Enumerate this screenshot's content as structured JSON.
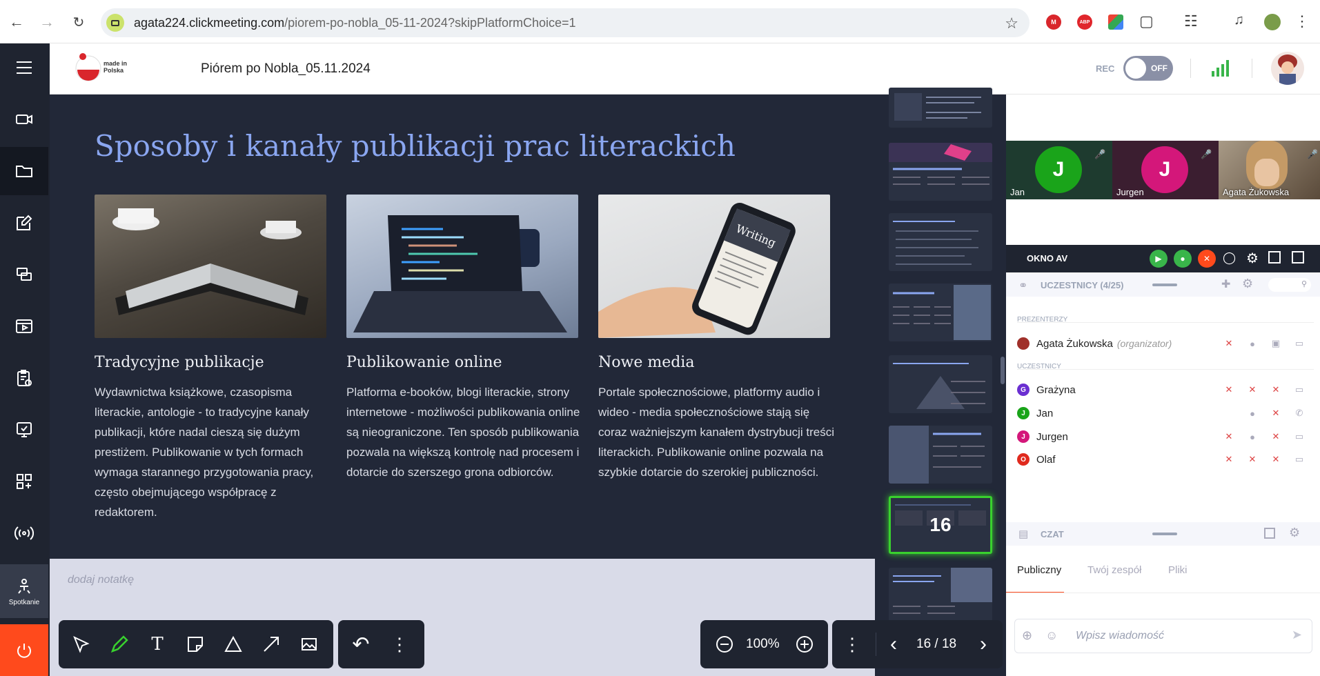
{
  "browser": {
    "url_host": "agata224.clickmeeting.com",
    "url_path": "/piorem-po-nobla_05-11-2024?skipPlatformChoice=1",
    "extensions": [
      "gmail-icon",
      "adblock-icon",
      "drive-icon",
      "puzzle-icon"
    ],
    "abp_label": "ABP"
  },
  "header": {
    "logo_text": "made in Polska",
    "title": "Piórem po Nobla_05.11.2024",
    "rec_label": "REC",
    "toggle_label": "OFF"
  },
  "rail": {
    "meeting_label": "Spotkanie"
  },
  "slide": {
    "title": "Sposoby i kanały publikacji prac literackich",
    "columns": [
      {
        "heading": "Tradycyjne publikacje",
        "body": "Wydawnictwa książkowe, czasopisma literackie, antologie - to tradycyjne kanały publikacji, które nadal cieszą się dużym prestiżem. Publikowanie w tych formach wymaga starannego przygotowania pracy, często obejmującego współpracę z redaktorem."
      },
      {
        "heading": "Publikowanie online",
        "body": "Platforma e-booków, blogi literackie, strony internetowe - możliwości publikowania online są nieograniczone. Ten sposób publikowania pozwala na większą kontrolę nad procesem i dotarcie do szerszego grona odbiorców."
      },
      {
        "heading": "Nowe media",
        "body": "Portale społecznościowe, platformy audio i wideo - media społecznościowe stają się coraz ważniejszym kanałem dystrybucji treści literackich. Publikowanie online pozwala na szybkie dotarcie do szerokiej publiczności."
      }
    ]
  },
  "notes": {
    "placeholder": "dodaj notatkę"
  },
  "thumbnails": {
    "current_number": "16"
  },
  "toolbar": {
    "zoom": "100%",
    "page": "16 / 18"
  },
  "video": {
    "tiles": [
      {
        "initial": "J",
        "name": "Jan",
        "color": "#1aa41a"
      },
      {
        "initial": "J",
        "name": "Jurgen",
        "color": "#d4177a"
      },
      {
        "initial": "",
        "name": "Agata Żukowska",
        "color": "#6b5a4a"
      }
    ]
  },
  "av": {
    "label": "OKNO AV"
  },
  "participants": {
    "header": "UCZESTNICY (4/25)",
    "presenters_label": "PREZENTERZY",
    "attendees_label": "UCZESTNICY",
    "presenter": {
      "name": "Agata Żukowska",
      "role": "(organizator)"
    },
    "people": [
      {
        "initial": "G",
        "name": "Grażyna",
        "color": "#6a2fd1"
      },
      {
        "initial": "J",
        "name": "Jan",
        "color": "#1aa41a"
      },
      {
        "initial": "J",
        "name": "Jurgen",
        "color": "#d4177a"
      },
      {
        "initial": "O",
        "name": "Olaf",
        "color": "#e02a1e"
      }
    ]
  },
  "chat": {
    "header": "CZAT",
    "tabs": [
      "Publiczny",
      "Twój zespół",
      "Pliki"
    ],
    "placeholder": "Wpisz wiadomość"
  },
  "colors": {
    "accent": "#ff4a1c",
    "rail": "#1f2430",
    "slide_bg": "#222838",
    "title_blue": "#8aa6f0",
    "active_thumb": "#39d12e"
  }
}
